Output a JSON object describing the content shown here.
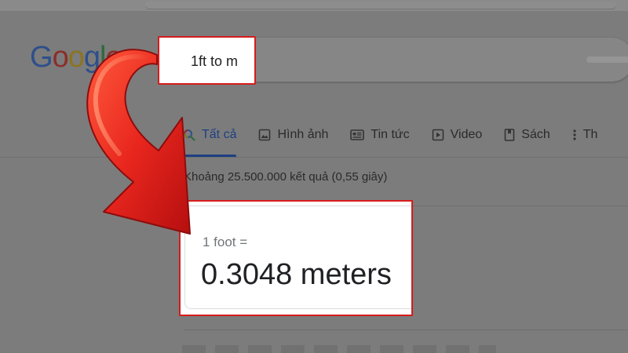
{
  "search": {
    "query": "1ft to m"
  },
  "logo": {
    "letters": [
      "G",
      "o",
      "o",
      "g",
      "l",
      "e"
    ]
  },
  "tabs": [
    {
      "label": "Tất cả",
      "icon": "search-icon"
    },
    {
      "label": "Hình ảnh",
      "icon": "image-icon"
    },
    {
      "label": "Tin tức",
      "icon": "news-icon"
    },
    {
      "label": "Video",
      "icon": "video-play-icon"
    },
    {
      "label": "Sách",
      "icon": "book-icon"
    },
    {
      "label": "Th",
      "icon": "more-vert-icon"
    }
  ],
  "results_stats": "Khoảng 25.500.000 kết quả (0,55 giây)",
  "answer": {
    "from": "1 foot =",
    "result": "0.3048 meters"
  },
  "colors": {
    "highlight_border": "#d71c1c",
    "arrow_red": "#e8261e",
    "overlay_gray": "#7c7c7c",
    "active_tab": "#1e3f82"
  }
}
